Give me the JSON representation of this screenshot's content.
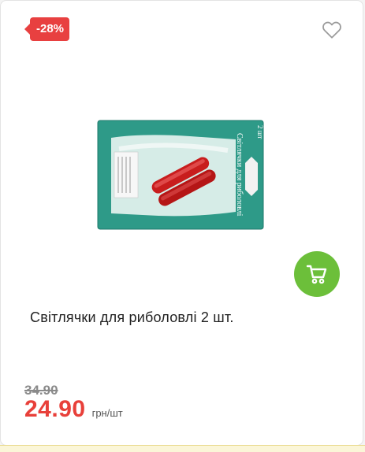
{
  "product": {
    "discount_badge": "-28%",
    "title": "Світлячки для риболовлі 2 шт.",
    "old_price": "34.90",
    "price": "24.90",
    "unit": "грн/шт",
    "package_text": {
      "count": "2 шт",
      "name": "Світлячки для риболовлі"
    }
  },
  "icons": {
    "favorite": "heart-outline-icon",
    "cart": "shopping-cart-icon"
  },
  "colors": {
    "badge": "#e84040",
    "price": "#e8403a",
    "cart_button": "#6cbf3a",
    "package": "#2e9a88"
  }
}
